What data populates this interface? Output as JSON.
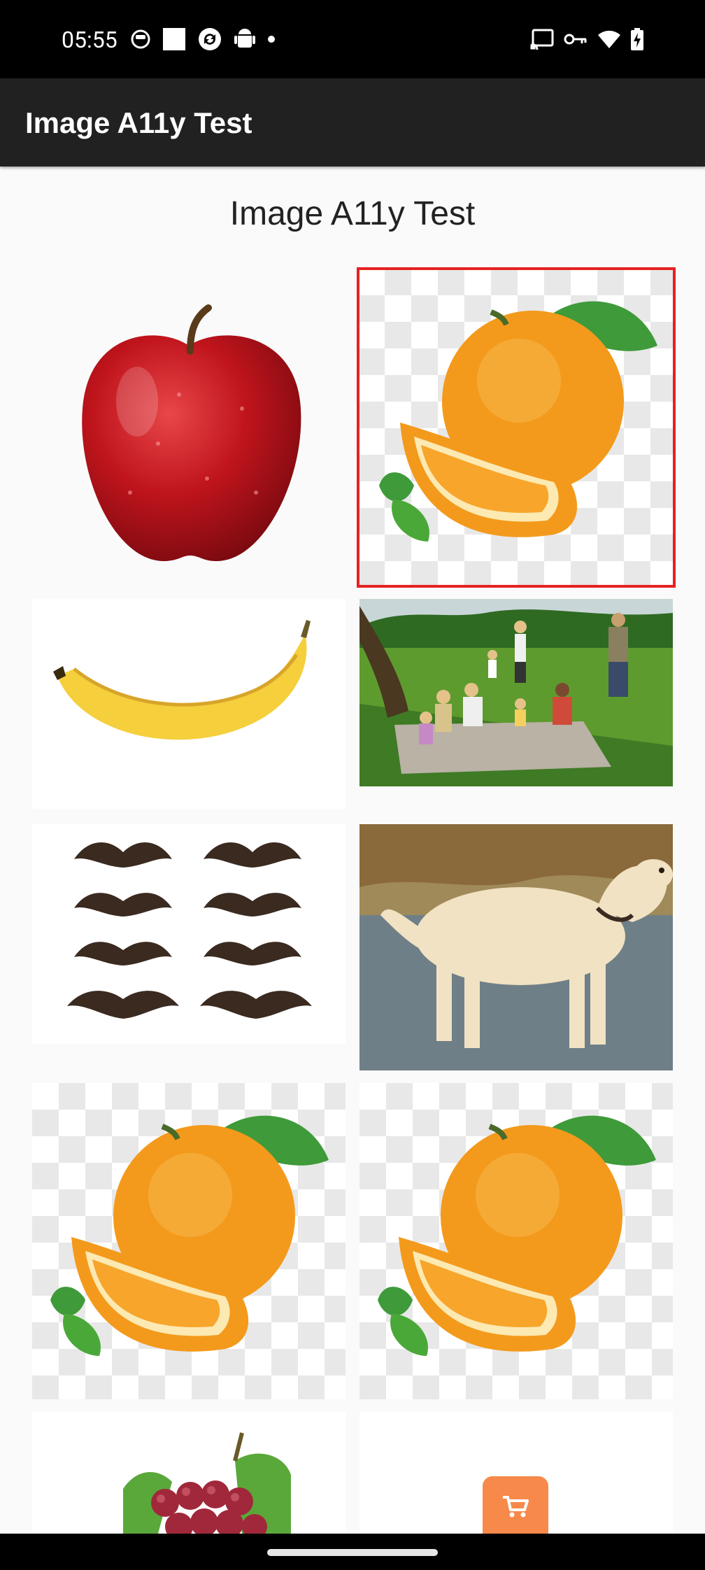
{
  "status_bar": {
    "time": "05:55",
    "left_icons": [
      "face-icon",
      "square-icon",
      "sync-icon",
      "android-icon",
      "dot-icon"
    ],
    "right_icons": [
      "cast-icon",
      "key-icon",
      "wifi-icon",
      "battery-charging-icon"
    ]
  },
  "app_bar": {
    "title": "Image A11y Test"
  },
  "page": {
    "title": "Image A11y Test"
  },
  "images": [
    {
      "subject": "apple",
      "selected": false
    },
    {
      "subject": "orange",
      "selected": true
    },
    {
      "subject": "banana",
      "selected": false
    },
    {
      "subject": "picnic",
      "selected": false
    },
    {
      "subject": "ornaments",
      "selected": false
    },
    {
      "subject": "dog",
      "selected": false
    },
    {
      "subject": "orange",
      "selected": false
    },
    {
      "subject": "orange",
      "selected": false
    },
    {
      "subject": "grapes",
      "selected": false
    },
    {
      "subject": "shopping-cart",
      "selected": false
    }
  ],
  "colors": {
    "status_bar": "#000000",
    "app_bar": "#212121",
    "background": "#fafafa",
    "selection_border": "#e52222",
    "cart_button": "#f7894a"
  }
}
